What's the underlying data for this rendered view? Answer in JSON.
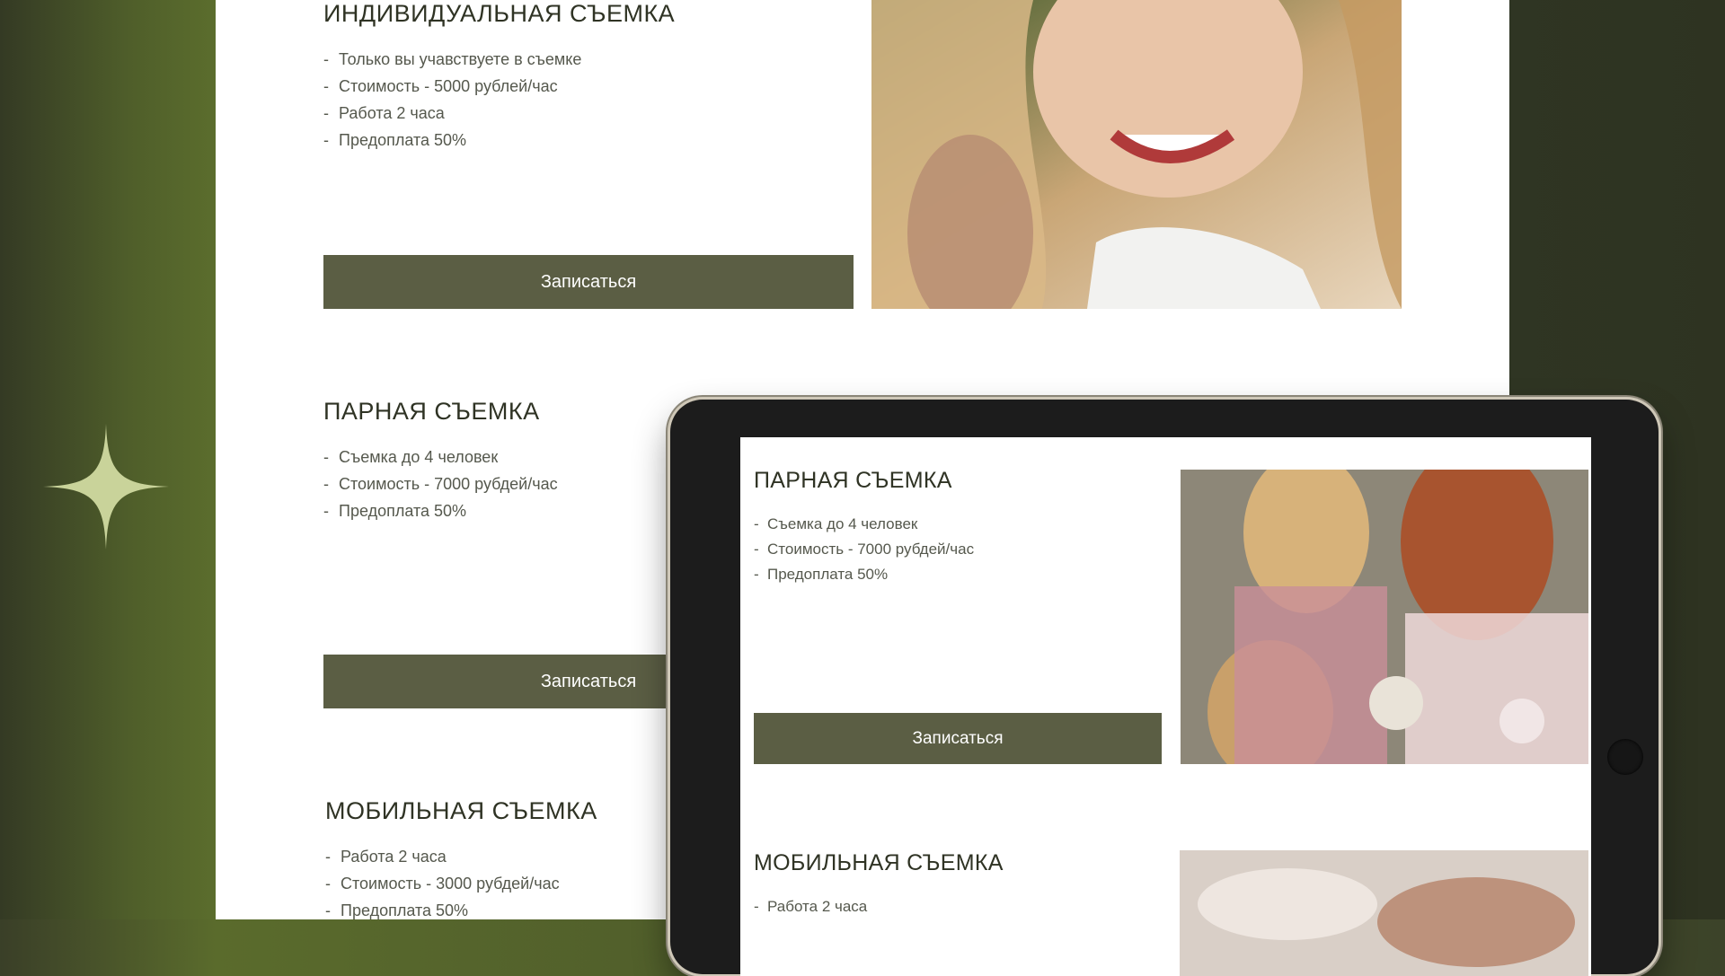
{
  "sections": [
    {
      "title": "ИНДИВИДУАЛЬНАЯ СЪЕМКА",
      "items": [
        "Только вы учавствуете в съемке",
        "Стоимость - 5000 рублей/час",
        "Работа 2 часа",
        "Предоплата 50%"
      ],
      "button": "Записаться"
    },
    {
      "title": "ПАРНАЯ СЪЕМКА",
      "items": [
        "Съемка до 4 человек",
        "Стоимость - 7000 рубдей/час",
        "Предоплата 50%"
      ],
      "button": "Записаться"
    },
    {
      "title": "МОБИЛЬНАЯ СЪЕМКА",
      "items": [
        "Работа 2 часа",
        "Стоимость - 3000 рубдей/час",
        "Предоплата 50%"
      ]
    }
  ],
  "tablet": {
    "sections": [
      {
        "title": "ПАРНАЯ СЪЕМКА",
        "items": [
          "Съемка до 4 человек",
          "Стоимость - 7000 рубдей/час",
          "Предоплата 50%"
        ],
        "button": "Записаться"
      },
      {
        "title": "МОБИЛЬНАЯ СЪЕМКА",
        "items": [
          "Работа 2 часа"
        ]
      }
    ]
  },
  "colors": {
    "accent": "#5b5e44",
    "background_olive": "#4f5e2a",
    "sparkle": "#c9d39a"
  },
  "icons": [
    "sparkle-icon"
  ]
}
